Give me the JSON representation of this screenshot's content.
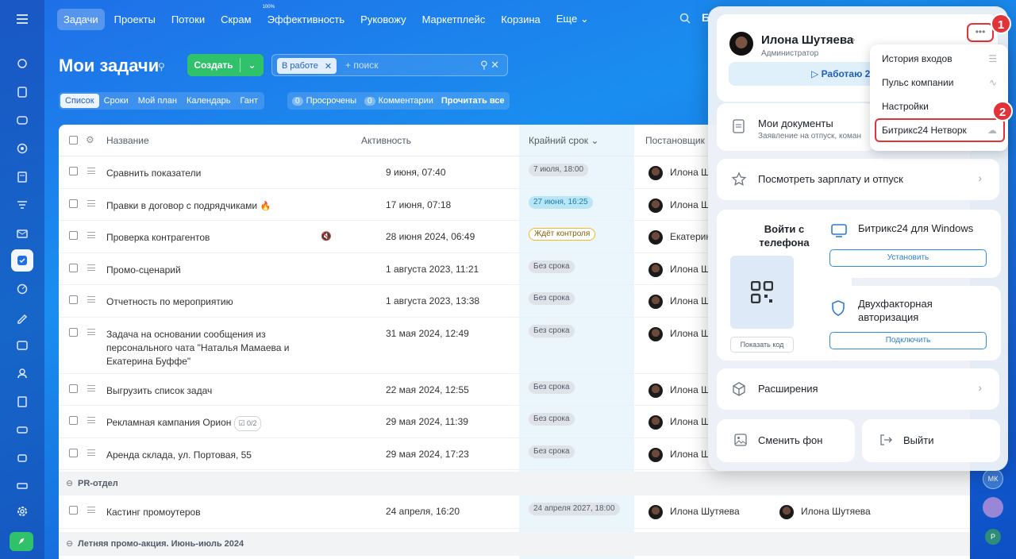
{
  "topnav": {
    "items": [
      "Задачи",
      "Проекты",
      "Потоки",
      "Скрам",
      "Эффективность",
      "Руковожу",
      "Маркетплейс",
      "Корзина",
      "Еще"
    ],
    "efficiency_sup": "100%",
    "more_chevron": "⌄",
    "cut_letter": "Б"
  },
  "header": {
    "title": "Мои задачи",
    "create_label": "Создать",
    "filter_chip": "В работе",
    "search_placeholder": "+ поиск"
  },
  "view_tabs": [
    "Список",
    "Сроки",
    "Мой план",
    "Календарь",
    "Гант"
  ],
  "counters": {
    "overdue_count": "0",
    "overdue_label": "Просрочены",
    "comments_count": "0",
    "comments_label": "Комментарии",
    "read_all": "Прочитать все"
  },
  "table": {
    "columns": {
      "name": "Название",
      "activity": "Активность",
      "deadline": "Крайний срок",
      "creator": "Постановщик"
    },
    "rows": [
      {
        "name": "Сравнить показатели",
        "activity": "9 июня, 07:40",
        "deadline": "7 июля, 18:00",
        "creator": "Илона Ш"
      },
      {
        "name": "Правки в договор с подрядчиками",
        "activity": "17 июня, 07:18",
        "deadline": "27 июня, 16:25",
        "creator": "Илона Ш"
      },
      {
        "name": "Проверка контрагентов",
        "activity": "28 июня 2024, 06:49",
        "deadline": "Ждёт контроля",
        "creator": "Екатерин"
      },
      {
        "name": "Промо-сценарий",
        "activity": "1 августа 2023, 11:21",
        "deadline": "Без срока",
        "creator": "Илона Ш"
      },
      {
        "name": "Отчетность по мероприятию",
        "activity": "1 августа 2023, 13:38",
        "deadline": "Без срока",
        "creator": "Илона Ш"
      },
      {
        "name": "Задача на основании сообщения из персонального чата \"Наталья Мамаева и Екатерина Буффе\"",
        "activity": "31 мая 2024, 12:49",
        "deadline": "Без срока",
        "creator": "Илона Ш"
      },
      {
        "name": "Выгрузить список задач",
        "activity": "22 мая 2024, 12:55",
        "deadline": "Без срока",
        "creator": "Илона Ш"
      },
      {
        "name": "Рекламная кампания Орион",
        "checklist": "0/2",
        "activity": "29 мая 2024, 11:39",
        "deadline": "Без срока",
        "creator": "Илона Ш"
      },
      {
        "name": "Аренда склада, ул. Портовая, 55",
        "activity": "29 мая 2024, 17:23",
        "deadline": "Без срока",
        "creator": "Илона Ш"
      }
    ],
    "group1": "PR-отдел",
    "group1_row": {
      "name": "Кастинг промоутеров",
      "activity": "24 апреля, 16:20",
      "deadline": "24 апреля 2027, 18:00",
      "creator": "Илона Шутяева",
      "responsible": "Илона Шутяева"
    },
    "group2": "Летняя промо-акция. Июнь-июль 2024"
  },
  "right_strip": {
    "avatar_initials": "МК",
    "avatar_letter": "Р"
  },
  "profile": {
    "name": "Илона Шутяева",
    "role": "Администратор",
    "work_button": "▷ Работаю 2",
    "documents_title": "Мои документы",
    "documents_sub": "Заявление на отпуск, коман",
    "salary": "Посмотреть зарплату и отпуск",
    "phone_login": "Войти с телефона",
    "show_code": "Показать код",
    "windows_title": "Битрикс24 для Windows",
    "install": "Установить",
    "tfa_title": "Двухфакторная авторизация",
    "connect": "Подключить",
    "extensions": "Расширения",
    "change_bg": "Сменить фон",
    "logout": "Выйти"
  },
  "menu": {
    "items": [
      "История входов",
      "Пульс компании",
      "Настройки",
      "Битрикс24 Нетворк"
    ]
  },
  "markers": [
    "1",
    "2"
  ],
  "colors": {
    "accent_red": "#e0333a",
    "create_green": "#2fc26b"
  }
}
